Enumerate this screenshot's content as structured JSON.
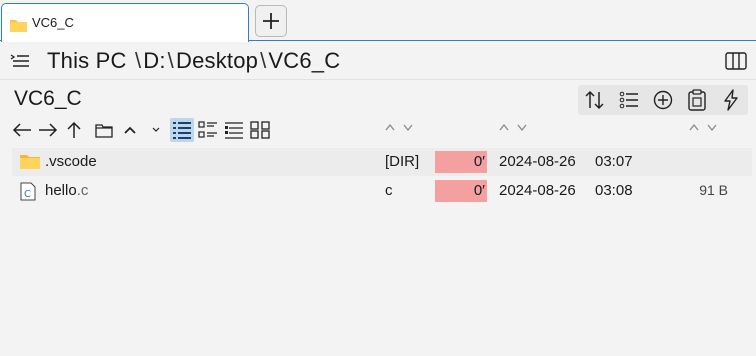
{
  "tab": {
    "title": "VC6_C"
  },
  "path": {
    "root": "This PC",
    "drive": "D:",
    "folder1": "Desktop",
    "folder2": "VC6_C"
  },
  "panel": {
    "title": "VC6_C"
  },
  "files": [
    {
      "name": ".vscode",
      "ext": "",
      "type": "[DIR]",
      "attr": "0′",
      "date": "2024-08-26",
      "time": "03:07",
      "size": ""
    },
    {
      "name": "hello",
      "ext": ".c",
      "type": "c",
      "attr": "0′",
      "date": "2024-08-26",
      "time": "03:08",
      "size": "91 B"
    }
  ],
  "icons": {
    "toolbar": [
      "sort-icon",
      "list-icon",
      "add-icon",
      "clipboard-icon",
      "lightning-icon"
    ],
    "nav": [
      "back-arrow-icon",
      "forward-arrow-icon",
      "up-arrow-icon",
      "new-folder-icon",
      "chevron-up-icon",
      "details-view-icon",
      "list-view-icon",
      "tree-view-icon",
      "grid-view-icon"
    ]
  },
  "colors": {
    "accent": "#2f7fd0",
    "selected_view": "#bcd6ee",
    "attr_highlight": "#f4a0a0",
    "folder": "#f5c44a"
  }
}
